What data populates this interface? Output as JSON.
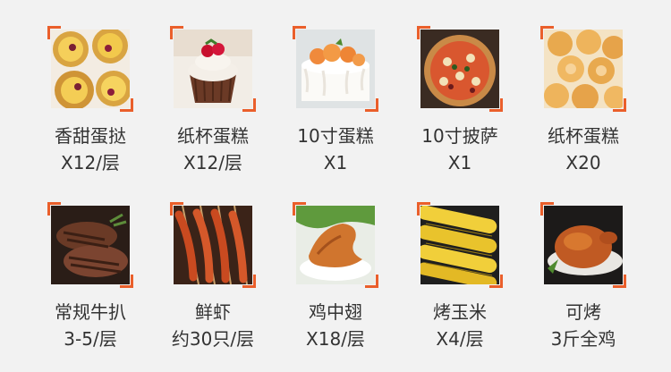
{
  "accent_color": "#ea5f2b",
  "foods": [
    {
      "name": "香甜蛋挞",
      "qty": "X12/层",
      "icon": "egg-tart-photo"
    },
    {
      "name": "纸杯蛋糕",
      "qty": "X12/层",
      "icon": "cupcake-photo"
    },
    {
      "name": "10寸蛋糕",
      "qty": "X1",
      "icon": "cake-photo"
    },
    {
      "name": "10寸披萨",
      "qty": "X1",
      "icon": "pizza-photo"
    },
    {
      "name": "纸杯蛋糕",
      "qty": "X20",
      "icon": "cookies-photo"
    },
    {
      "name": "常规牛扒",
      "qty": "3-5/层",
      "icon": "steak-photo"
    },
    {
      "name": "鲜虾",
      "qty": "约30只/层",
      "icon": "shrimp-skewer-photo"
    },
    {
      "name": "鸡中翅",
      "qty": "X18/层",
      "icon": "chicken-wing-photo"
    },
    {
      "name": "烤玉米",
      "qty": "X4/层",
      "icon": "corn-photo"
    },
    {
      "name": "可烤",
      "qty": "3斤全鸡",
      "icon": "roast-chicken-photo"
    }
  ]
}
